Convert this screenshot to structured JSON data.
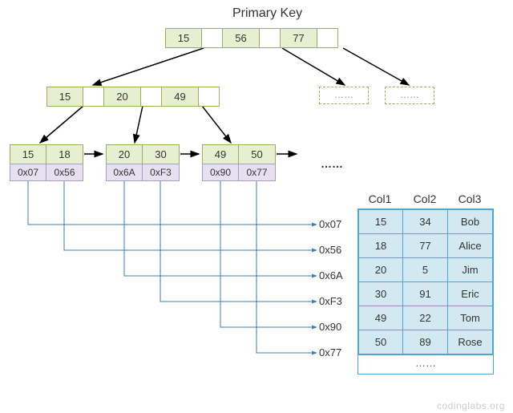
{
  "title": "Primary Key",
  "root": {
    "k1": "15",
    "k2": "56",
    "k3": "77"
  },
  "internal": {
    "k1": "15",
    "k2": "20",
    "k3": "49"
  },
  "ghost_label": "……",
  "leaves": [
    {
      "k1": "15",
      "k2": "18",
      "a1": "0x07",
      "a2": "0x56"
    },
    {
      "k1": "20",
      "k2": "30",
      "a1": "0x6A",
      "a2": "0xF3"
    },
    {
      "k1": "49",
      "k2": "50",
      "a1": "0x90",
      "a2": "0x77"
    }
  ],
  "leaf_ellipsis": "……",
  "pointer_labels": [
    "0x07",
    "0x56",
    "0x6A",
    "0xF3",
    "0x90",
    "0x77"
  ],
  "table": {
    "headers": [
      "Col1",
      "Col2",
      "Col3"
    ],
    "rows": [
      [
        "15",
        "34",
        "Bob"
      ],
      [
        "18",
        "77",
        "Alice"
      ],
      [
        "20",
        "5",
        "Jim"
      ],
      [
        "30",
        "91",
        "Eric"
      ],
      [
        "49",
        "22",
        "Tom"
      ],
      [
        "50",
        "89",
        "Rose"
      ]
    ],
    "ellipsis": "……"
  },
  "watermark": "codinglabs.org",
  "chart_data": {
    "type": "diagram",
    "description": "B+ tree secondary index on Primary Key. Root node keys 15,56,77. One internal child shown with keys 15,20,49 (siblings shown as dashed placeholders). Three leaf nodes: (15→0x07, 18→0x56), (20→0x6A, 30→0xF3), (49→0x90, 50→0x77) linked left-to-right. Each leaf address points to a row in a data table with columns Col1, Col2, Col3.",
    "root_keys": [
      15,
      56,
      77
    ],
    "internal_keys": [
      15,
      20,
      49
    ],
    "leaves": [
      {
        "keys": [
          15,
          18
        ],
        "pointers": [
          "0x07",
          "0x56"
        ]
      },
      {
        "keys": [
          20,
          30
        ],
        "pointers": [
          "0x6A",
          "0xF3"
        ]
      },
      {
        "keys": [
          49,
          50
        ],
        "pointers": [
          "0x90",
          "0x77"
        ]
      }
    ],
    "data_table": {
      "columns": [
        "Col1",
        "Col2",
        "Col3"
      ],
      "rows": [
        {
          "Col1": 15,
          "Col2": 34,
          "Col3": "Bob",
          "addr": "0x07"
        },
        {
          "Col1": 18,
          "Col2": 77,
          "Col3": "Alice",
          "addr": "0x56"
        },
        {
          "Col1": 20,
          "Col2": 5,
          "Col3": "Jim",
          "addr": "0x6A"
        },
        {
          "Col1": 30,
          "Col2": 91,
          "Col3": "Eric",
          "addr": "0xF3"
        },
        {
          "Col1": 49,
          "Col2": 22,
          "Col3": "Tom",
          "addr": "0x90"
        },
        {
          "Col1": 50,
          "Col2": 89,
          "Col3": "Rose",
          "addr": "0x77"
        }
      ]
    }
  }
}
